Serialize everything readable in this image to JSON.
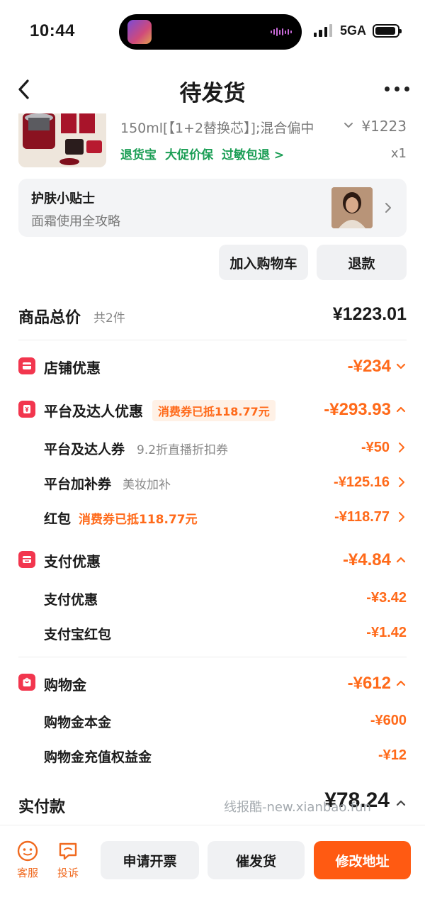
{
  "status_bar": {
    "time": "10:44",
    "network": "5GA"
  },
  "header": {
    "title": "待发货"
  },
  "product": {
    "name": "150ml[【1+2替换芯】];混合偏中",
    "price": "¥1223",
    "tags": [
      "退货宝",
      "大促价保",
      "过敏包退 >"
    ],
    "qty": "x1"
  },
  "tips": {
    "title": "护肤小贴士",
    "subtitle": "面霜使用全攻略"
  },
  "actions": {
    "add_cart": "加入购物车",
    "refund": "退款"
  },
  "total": {
    "label": "商品总价",
    "count": "共2件",
    "value": "¥1223.01"
  },
  "discounts": {
    "store": {
      "label": "店铺优惠",
      "value": "-¥234"
    },
    "platform": {
      "label": "平台及达人优惠",
      "tag": "消费券已抵118.77元",
      "value": "-¥293.93",
      "items": [
        {
          "label": "平台及达人券",
          "note": "9.2折直播折扣券",
          "value": "-¥50"
        },
        {
          "label": "平台加补券",
          "note": "美妆加补",
          "value": "-¥125.16"
        },
        {
          "label": "红包",
          "note": "消费券已抵118.77元",
          "value": "-¥118.77"
        }
      ]
    },
    "payment": {
      "label": "支付优惠",
      "value": "-¥4.84",
      "items": [
        {
          "label": "支付优惠",
          "value": "-¥3.42"
        },
        {
          "label": "支付宝红包",
          "value": "-¥1.42"
        }
      ]
    },
    "shopping_gold": {
      "label": "购物金",
      "value": "-¥612",
      "items": [
        {
          "label": "购物金本金",
          "value": "-¥600"
        },
        {
          "label": "购物金充值权益金",
          "value": "-¥12"
        }
      ]
    }
  },
  "paid": {
    "label": "实付款",
    "value": "¥78.24",
    "watermark": "线报酷-new.xianbao.fun"
  },
  "bottom": {
    "service": "客服",
    "complain": "投诉",
    "invoice": "申请开票",
    "urge": "催发货",
    "modify_address": "修改地址"
  },
  "colors": {
    "accent": "#ff5a12",
    "discount": "#ff6a1a",
    "tag_green": "#1b9e55",
    "icon_red": "#f2364e"
  }
}
